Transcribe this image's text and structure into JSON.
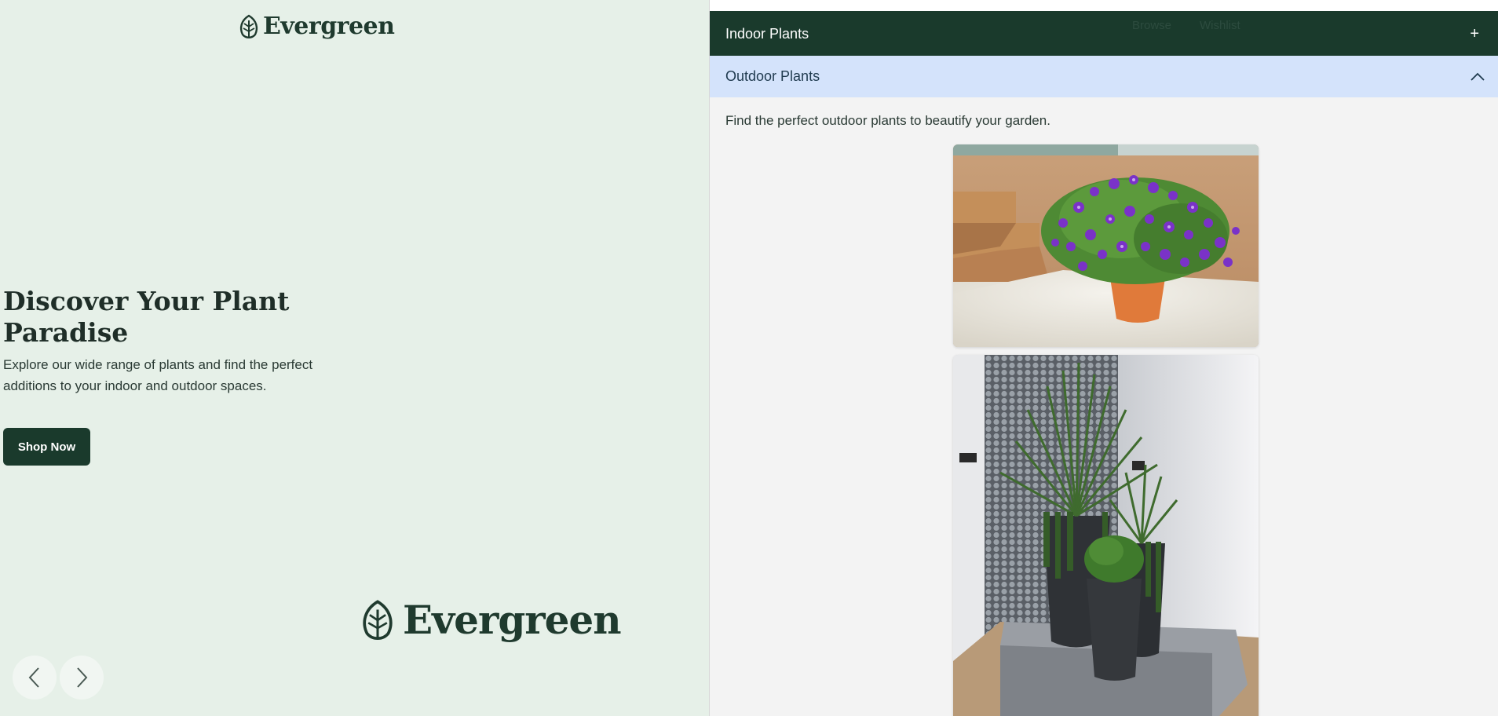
{
  "brand": {
    "name": "Evergreen",
    "color": "#1f3a2e"
  },
  "hero": {
    "title": "Discover Your Plant Paradise",
    "description": "Explore our wide range of plants and find the perfect additions to your indoor and outdoor spaces.",
    "cta_label": "Shop Now",
    "prev_icon": "chevron-left-icon",
    "next_icon": "chevron-right-icon"
  },
  "nav": {
    "browse": "Browse",
    "wishlist": "Wishlist"
  },
  "accordion": {
    "indoor": {
      "label": "Indoor Plants",
      "toggle": "+",
      "expanded": false
    },
    "outdoor": {
      "label": "Outdoor Plants",
      "toggle_icon": "chevron-up-icon",
      "expanded": true,
      "description": "Find the perfect outdoor plants to beautify your garden."
    }
  },
  "colors": {
    "hero_bg": "#e6f0e8",
    "dark_green": "#1a3a2c",
    "active_accordion": "#d4e3fb",
    "panel_bg": "#f3f3f3"
  }
}
